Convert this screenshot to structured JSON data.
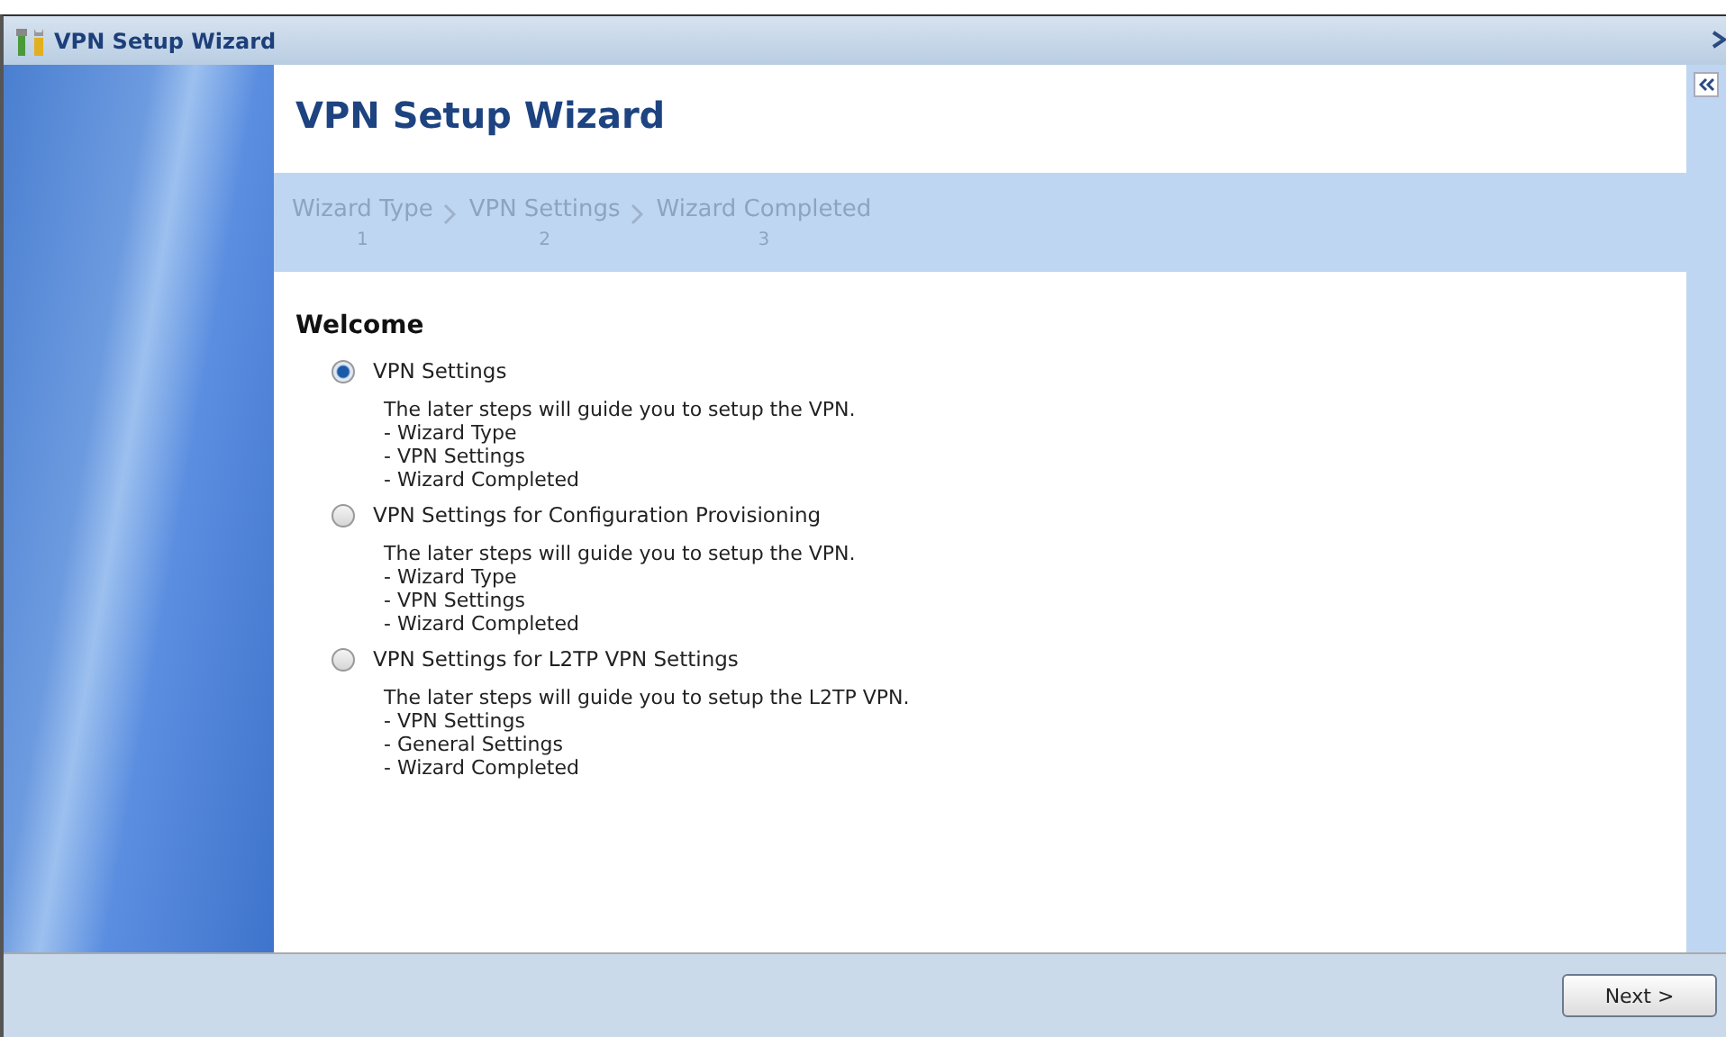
{
  "window": {
    "title": "VPN Setup Wizard"
  },
  "heading": "VPN Setup Wizard",
  "steps": [
    {
      "label": "Wizard Type",
      "number": "1"
    },
    {
      "label": "VPN Settings",
      "number": "2"
    },
    {
      "label": "Wizard Completed",
      "number": "3"
    }
  ],
  "section_title": "Welcome",
  "options": [
    {
      "label": "VPN Settings",
      "selected": true,
      "description": [
        "The later steps will guide you to setup the VPN.",
        "- Wizard Type",
        "- VPN Settings",
        "- Wizard Completed"
      ]
    },
    {
      "label": "VPN Settings for Configuration Provisioning",
      "selected": false,
      "description": [
        "The later steps will guide you to setup the VPN.",
        "- Wizard Type",
        "- VPN Settings",
        "- Wizard Completed"
      ]
    },
    {
      "label": "VPN Settings for L2TP VPN Settings",
      "selected": false,
      "description": [
        "The later steps will guide you to setup the L2TP VPN.",
        "- VPN Settings",
        "- General Settings",
        "- Wizard Completed"
      ]
    }
  ],
  "buttons": [
    {
      "label": "Next >"
    }
  ]
}
